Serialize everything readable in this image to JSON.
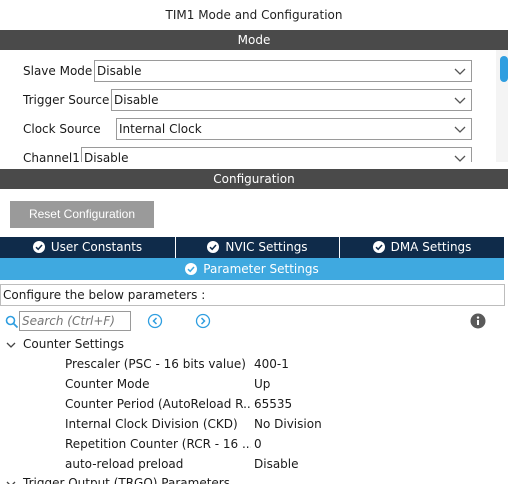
{
  "window": {
    "title": "TIM1 Mode and Configuration"
  },
  "mode_section": {
    "header": "Mode",
    "fields": [
      {
        "label": "Slave Mode",
        "value": "Disable"
      },
      {
        "label": "Trigger Source",
        "value": "Disable"
      },
      {
        "label": "Clock Source",
        "value": "Internal Clock"
      },
      {
        "label": "Channel1",
        "value": "Disable"
      }
    ]
  },
  "config_section": {
    "header": "Configuration",
    "reset_button": "Reset Configuration",
    "tabs": [
      {
        "label": "User Constants"
      },
      {
        "label": "NVIC Settings"
      },
      {
        "label": "DMA Settings"
      },
      {
        "label": "Parameter Settings"
      }
    ],
    "description": "Configure the below parameters :",
    "search": {
      "placeholder": "Search (Ctrl+F)"
    },
    "groups": [
      {
        "title": "Counter Settings",
        "params": [
          {
            "name": "Prescaler (PSC - 16 bits value)",
            "value": "400-1"
          },
          {
            "name": "Counter Mode",
            "value": "Up"
          },
          {
            "name": "Counter Period (AutoReload R...",
            "value": "65535"
          },
          {
            "name": "Internal Clock Division (CKD)",
            "value": "No Division"
          },
          {
            "name": "Repetition Counter (RCR - 16 ...",
            "value": "0"
          },
          {
            "name": "auto-reload preload",
            "value": "Disable"
          }
        ]
      },
      {
        "title": "Trigger Output (TRGO) Parameters"
      }
    ]
  },
  "colors": {
    "section_bar": "#4a4a4a",
    "tab_dark": "#0f2b4a",
    "tab_active": "#3fa9e0",
    "accent_blue": "#2f9ee0",
    "reset_button": "#9a9a9a"
  },
  "icons": {
    "chevron": "chevron-down-icon",
    "check": "check-circle-icon",
    "search": "search-icon",
    "prev": "arrow-left-circle-icon",
    "next": "arrow-right-circle-icon",
    "info": "info-icon",
    "tree": "chevron-down-icon"
  }
}
